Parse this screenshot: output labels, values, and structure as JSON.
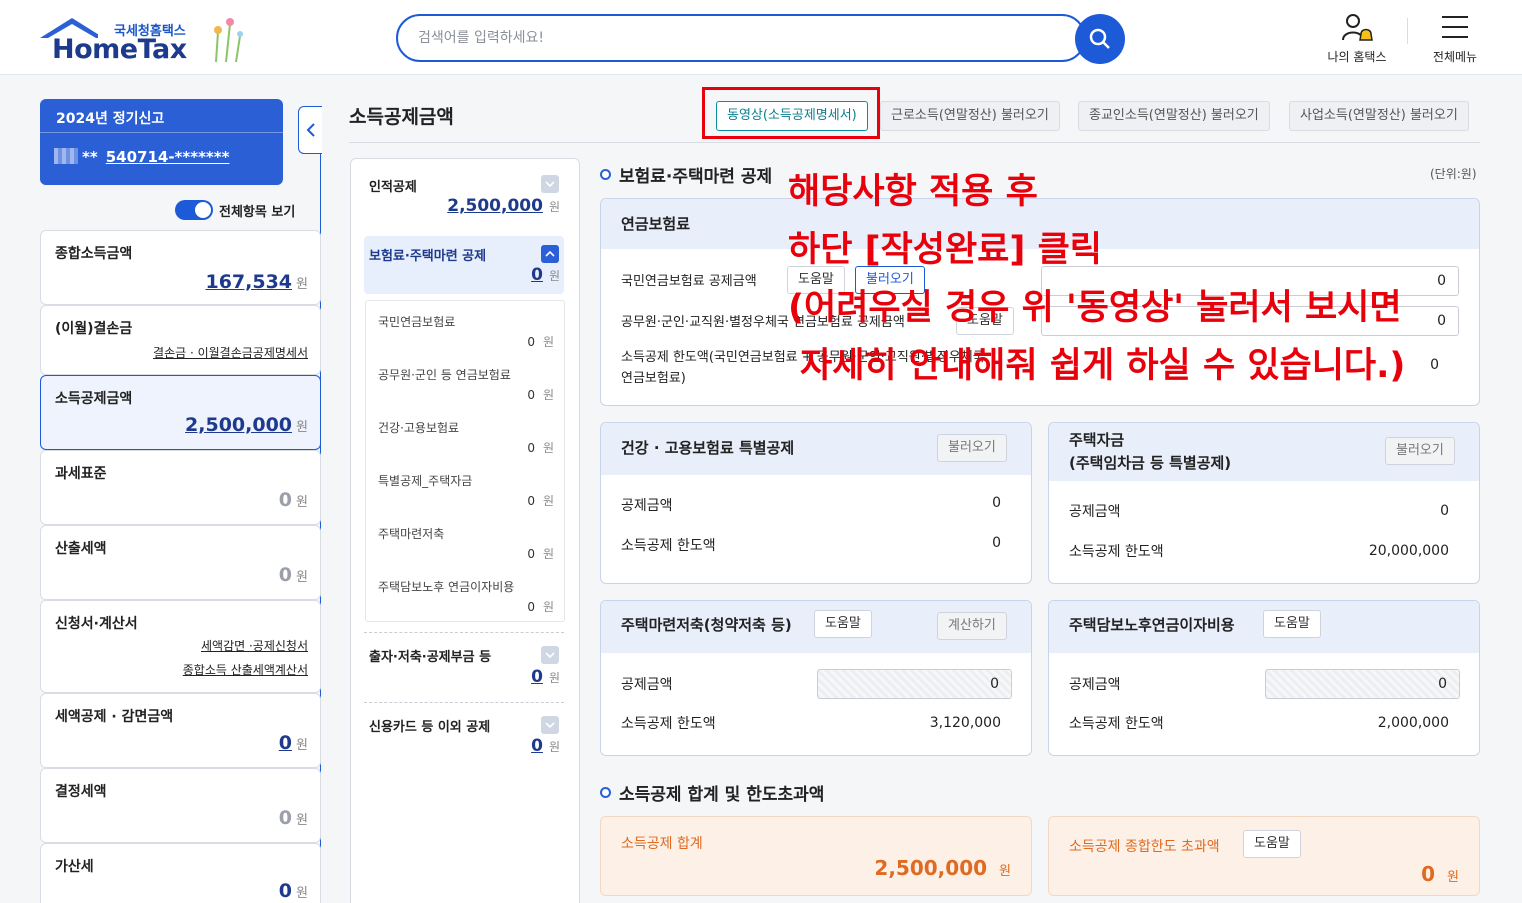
{
  "header": {
    "logo_sub": "국세청홈택스",
    "logo_main": "HomeTax",
    "search_placeholder": "검색어를 입력하세요!",
    "my_hometax": "나의 홈택스",
    "all_menu": "전체메뉴"
  },
  "sidebar": {
    "filing_title": "2024년 정기신고",
    "filing_id_mask": "**",
    "filing_id": "540714-*******",
    "toggle_label": "전체항목 보기",
    "cards": [
      {
        "title": "종합소득금액",
        "value": "167,534",
        "unit": "원"
      },
      {
        "title": "(이월)결손금",
        "link": "결손금 · 이월결손금공제명세서"
      },
      {
        "title": "소득공제금액",
        "value": "2,500,000",
        "unit": "원"
      },
      {
        "title": "과세표준",
        "value": "0",
        "unit": "원"
      },
      {
        "title": "산출세액",
        "value": "0",
        "unit": "원"
      },
      {
        "title": "신청서·계산서",
        "link1": "세액감면 ·공제신청서",
        "link2": "종합소득 산출세액계산서"
      },
      {
        "title": "세액공제 · 감면금액",
        "value": "0",
        "unit": "원"
      },
      {
        "title": "결정세액",
        "value": "0",
        "unit": "원"
      },
      {
        "title": "가산세",
        "value": "0",
        "unit": "원"
      }
    ]
  },
  "main": {
    "page_title": "소득공제금액",
    "tabs": [
      "동영상(소득공제명세서)",
      "근로소득(연말정산) 불러오기",
      "종교인소득(연말정산) 불러오기",
      "사업소득(연말정산) 불러오기"
    ],
    "unit_note": "(단위:원)"
  },
  "nav": {
    "groups": [
      {
        "title": "인적공제",
        "value": "2,500,000",
        "unit": "원"
      },
      {
        "title": "보험료·주택마련 공제",
        "value": "0",
        "unit": "원"
      },
      {
        "title": "출자·저축·공제부금 등",
        "value": "0",
        "unit": "원"
      },
      {
        "title": "신용카드 등 이외 공제",
        "value": "0",
        "unit": "원"
      }
    ],
    "subitems": [
      {
        "title": "국민연금보험료",
        "value": "0",
        "unit": "원"
      },
      {
        "title": "공무원·군인 등 연금보험료",
        "value": "0",
        "unit": "원"
      },
      {
        "title": "건강·고용보험료",
        "value": "0",
        "unit": "원"
      },
      {
        "title": "특별공제_주택자금",
        "value": "0",
        "unit": "원"
      },
      {
        "title": "주택마련저축",
        "value": "0",
        "unit": "원"
      },
      {
        "title": "주택담보노후 연금이자비용",
        "value": "0",
        "unit": "원"
      }
    ]
  },
  "section1": {
    "heading": "보험료·주택마련 공제",
    "pension": {
      "title": "연금보험료",
      "row1_label": "국민연금보험료 공제금액",
      "row1_help": "도움말",
      "row1_load": "불러오기",
      "row1_value": "0",
      "row2_label": "공무원·군인·교직원·별정우체국 연금보험료 공제금액",
      "row2_help": "도움말",
      "row2_value": "0",
      "row3_label_1": "소득공제 한도액(국민연금보험료 + 공무원·군인·교직원·별정우체국",
      "row3_label_2": "연금보험료)",
      "row3_value": "0"
    },
    "health": {
      "title": "건강 · 고용보험료 특별공제",
      "load": "불러오기",
      "amount_label": "공제금액",
      "amount_value": "0",
      "limit_label": "소득공제 한도액",
      "limit_value": "0"
    },
    "housing_fund": {
      "title_1": "주택자금",
      "title_2": "(주택임차금 등 특별공제)",
      "load": "불러오기",
      "amount_label": "공제금액",
      "amount_value": "0",
      "limit_label": "소득공제 한도액",
      "limit_value": "20,000,000"
    },
    "savings": {
      "title": "주택마련저축(청약저축 등)",
      "help": "도움말",
      "calc": "계산하기",
      "amount_label": "공제금액",
      "amount_value": "0",
      "limit_label": "소득공제 한도액",
      "limit_value": "3,120,000"
    },
    "mortgage": {
      "title": "주택담보노후연금이자비용",
      "help": "도움말",
      "amount_label": "공제금액",
      "amount_value": "0",
      "limit_label": "소득공제 한도액",
      "limit_value": "2,000,000"
    }
  },
  "section2": {
    "heading": "소득공제 합계 및 한도초과액",
    "total_label": "소득공제 합계",
    "total_value": "2,500,000",
    "total_unit": "원",
    "excess_label": "소득공제 종합한도 초과액",
    "excess_help": "도움말",
    "excess_value": "0",
    "excess_unit": "원"
  },
  "overlay": {
    "line1": "해당사항 적용 후",
    "line2": "하단 [작성완료] 클릭",
    "line3": "(어려우실 경우 위 '동영상' 눌러서 보시면",
    "line4": "자세히 안내해줘 쉽게 하실 수 있습니다.)"
  },
  "colors": {
    "brand_blue": "#1d5ad8",
    "navy": "#1d3a8c",
    "annotation_red": "#e8000b",
    "orange": "#e06a20"
  }
}
